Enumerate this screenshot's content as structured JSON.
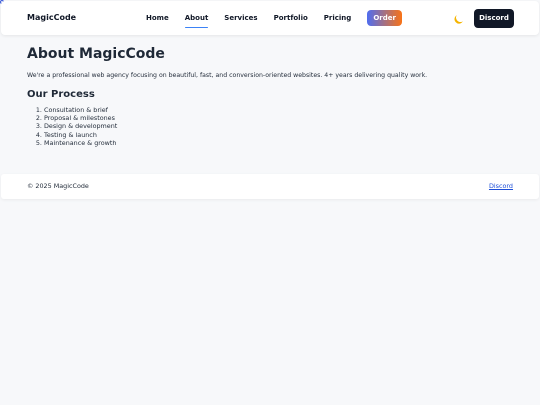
{
  "header": {
    "brand": "MagicCode",
    "nav": [
      {
        "label": "Home",
        "active": false
      },
      {
        "label": "About",
        "active": true
      },
      {
        "label": "Services",
        "active": false
      },
      {
        "label": "Portfolio",
        "active": false
      },
      {
        "label": "Pricing",
        "active": false
      }
    ],
    "order_label": "Order",
    "theme_toggle_icon": "moon-icon",
    "discord_label": "Discord"
  },
  "main": {
    "title": "About MagicCode",
    "intro": "We're a professional web agency focusing on beautiful, fast, and conversion-oriented websites. 4+ years delivering quality work.",
    "process_title": "Our Process",
    "steps": [
      "Consultation & brief",
      "Proposal & milestones",
      "Design & development",
      "Testing & launch",
      "Maintenance & growth"
    ]
  },
  "footer": {
    "copyright": "© 2025 MagicCode",
    "discord_link": "Discord"
  },
  "colors": {
    "accent": "#3b82f6",
    "order_gradient_start": "#4f6df0",
    "order_gradient_end": "#f97316",
    "dark_button": "#111827",
    "moon": "#f5b400",
    "link": "#1d4ed8"
  }
}
